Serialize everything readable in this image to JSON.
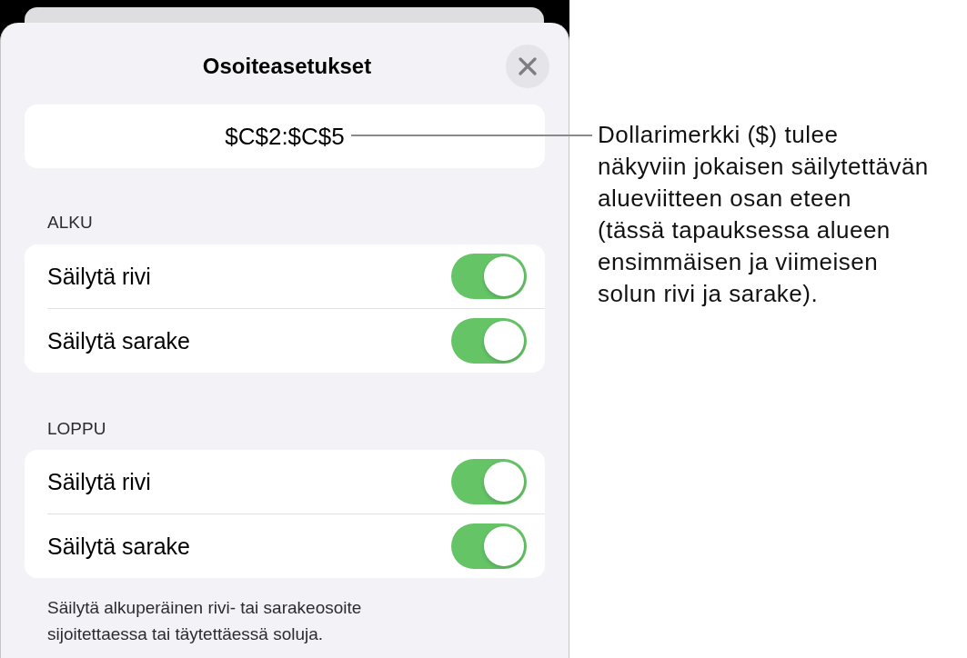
{
  "sheet": {
    "title": "Osoiteasetukset",
    "address": "$C$2:$C$5",
    "sections": [
      {
        "header": "ALKU",
        "rows": [
          {
            "label": "Säilytä rivi",
            "on": true
          },
          {
            "label": "Säilytä sarake",
            "on": true
          }
        ]
      },
      {
        "header": "LOPPU",
        "rows": [
          {
            "label": "Säilytä rivi",
            "on": true
          },
          {
            "label": "Säilytä sarake",
            "on": true
          }
        ]
      }
    ],
    "footer": "Säilytä alkuperäinen rivi- tai sarakeosoite\nsijoitettaessa tai täytettäessä soluja."
  },
  "callout": {
    "text": "Dollarimerkki ($) tulee\nnäkyviin jokaisen säilytettävän\nalueviitteen osan eteen\n(tässä tapauksessa alueen\nensimmäisen ja viimeisen\nsolun rivi ja sarake)."
  }
}
